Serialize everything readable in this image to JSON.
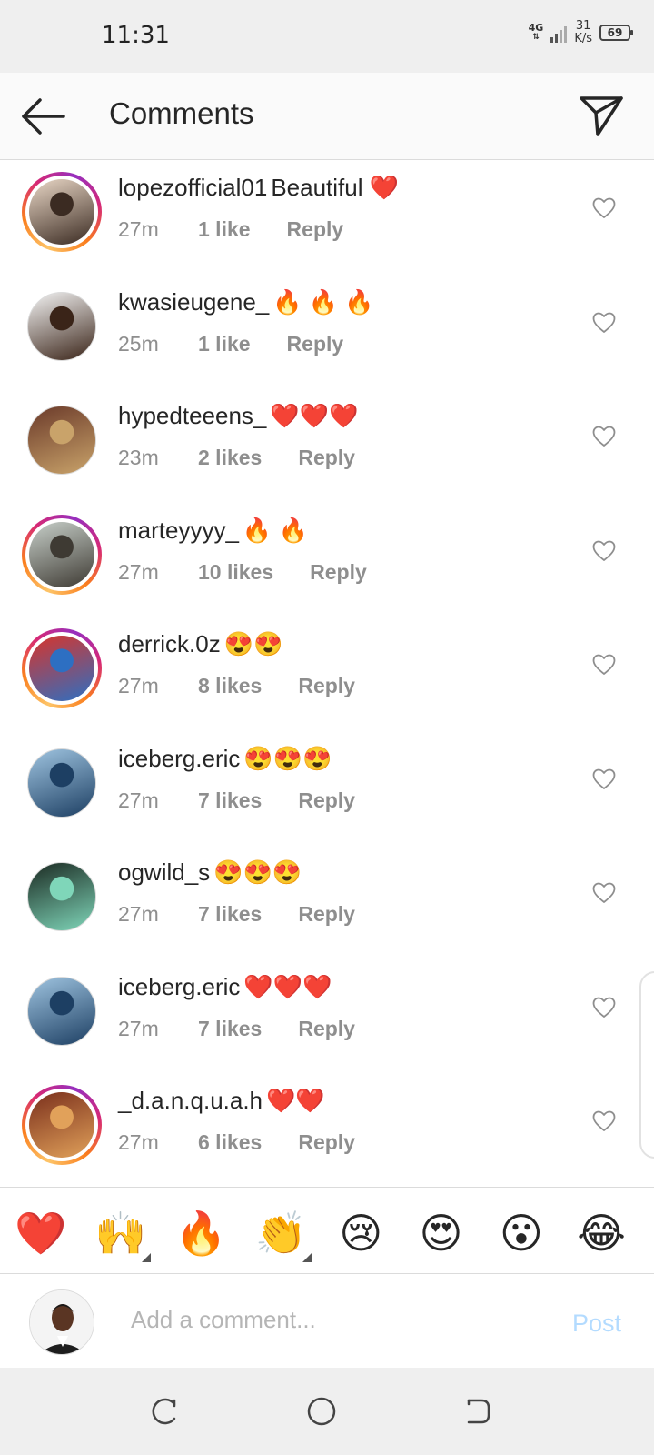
{
  "status_bar": {
    "time": "11:31",
    "network": "4G",
    "speed_value": "31",
    "speed_unit": "K/s",
    "battery": "69"
  },
  "header": {
    "title": "Comments",
    "back_icon": "arrow-left-icon",
    "share_icon": "paper-plane-icon"
  },
  "comments": [
    {
      "username": "lopezofficial01",
      "text": "Beautiful ❤️",
      "time": "27m",
      "likes": "1 like",
      "reply": "Reply",
      "has_story_ring": true,
      "avatar_colors": [
        "#e9d7c6",
        "#3b2b22"
      ]
    },
    {
      "username": "kwasieugene_",
      "text": "🔥 🔥 🔥",
      "time": "25m",
      "likes": "1 like",
      "reply": "Reply",
      "has_story_ring": false,
      "avatar_colors": [
        "#f3f3f3",
        "#3a2418"
      ]
    },
    {
      "username": "hypedteeens_",
      "text": "❤️❤️❤️",
      "time": "23m",
      "likes": "2 likes",
      "reply": "Reply",
      "has_story_ring": false,
      "avatar_colors": [
        "#6b3a2a",
        "#c9a36a"
      ]
    },
    {
      "username": "marteyyyy_",
      "text": "🔥 🔥",
      "time": "27m",
      "likes": "10 likes",
      "reply": "Reply",
      "has_story_ring": true,
      "avatar_colors": [
        "#c7cfc9",
        "#3e3a33"
      ]
    },
    {
      "username": "derrick.0z",
      "text": "😍😍",
      "time": "27m",
      "likes": "8 likes",
      "reply": "Reply",
      "has_story_ring": true,
      "avatar_colors": [
        "#d8342b",
        "#2d6fc2"
      ]
    },
    {
      "username": "iceberg.eric",
      "text": "😍😍😍",
      "time": "27m",
      "likes": "7 likes",
      "reply": "Reply",
      "has_story_ring": false,
      "avatar_colors": [
        "#9fc4e0",
        "#1d3f63"
      ]
    },
    {
      "username": "ogwild_s",
      "text": "😍😍😍",
      "time": "27m",
      "likes": "7 likes",
      "reply": "Reply",
      "has_story_ring": false,
      "avatar_colors": [
        "#1b2a22",
        "#7fd6b9"
      ]
    },
    {
      "username": "iceberg.eric",
      "text": "❤️❤️❤️",
      "time": "27m",
      "likes": "7 likes",
      "reply": "Reply",
      "has_story_ring": false,
      "avatar_colors": [
        "#9fc4e0",
        "#1d3f63"
      ]
    },
    {
      "username": "_d.a.n.q.u.a.h",
      "text": "❤️❤️",
      "time": "27m",
      "likes": "6 likes",
      "reply": "Reply",
      "has_story_ring": true,
      "avatar_colors": [
        "#7a2f1c",
        "#e1a15a"
      ]
    }
  ],
  "emoji_bar": [
    {
      "emoji": "❤️",
      "has_variants": false
    },
    {
      "emoji": "🙌",
      "has_variants": true
    },
    {
      "emoji": "🔥",
      "has_variants": false
    },
    {
      "emoji": "👏",
      "has_variants": true
    },
    {
      "emoji": "😢",
      "has_variants": false
    },
    {
      "emoji": "😍",
      "has_variants": false
    },
    {
      "emoji": "😮",
      "has_variants": false
    },
    {
      "emoji": "😂",
      "has_variants": false
    }
  ],
  "composer": {
    "placeholder": "Add a comment...",
    "post_label": "Post"
  },
  "nav_bar": {
    "buttons": [
      "recent-apps-icon",
      "home-icon",
      "back-icon"
    ]
  },
  "colors": {
    "accent_post_disabled": "#b3dbff",
    "meta_gray": "#8e8e8e",
    "text": "#262626"
  }
}
